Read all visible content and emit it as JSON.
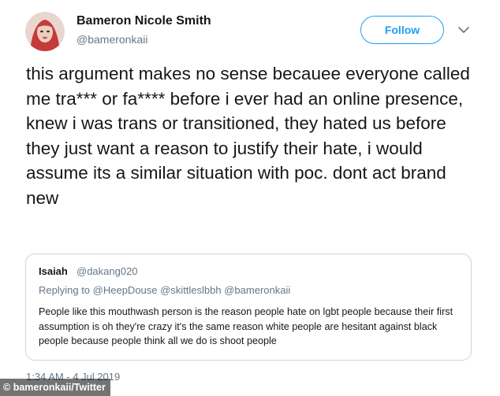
{
  "tweet": {
    "author_name": "Bameron Nicole Smith",
    "author_handle": "@bameronkaii",
    "follow_label": "Follow",
    "text": "this argument makes no sense becauee everyone called me tra*** or fa**** before i ever had an online presence, knew i was trans or transitioned, they hated us before they just want a reason to justify their hate, i would assume its a similar situation with poc. dont act brand new",
    "timestamp": "1:34 AM - 4 Jul 2019"
  },
  "quoted_tweet": {
    "author_name": "Isaiah",
    "author_handle": "@dakang020",
    "replying_to": "Replying to @HeepDouse @skittleslbbh @bameronkaii",
    "text": "People like this mouthwash person is the reason people hate on lgbt people because their first assumption is oh they're crazy it's the same reason white people are hesitant against black people because people think all we do is shoot people"
  },
  "credit": "bameronkaii/Twitter",
  "colors": {
    "accent": "#1da1f2",
    "secondary_text": "#657786",
    "border": "#ccd6dd"
  },
  "icons": {
    "menu": "chevron-down-icon",
    "avatar": "avatar"
  }
}
